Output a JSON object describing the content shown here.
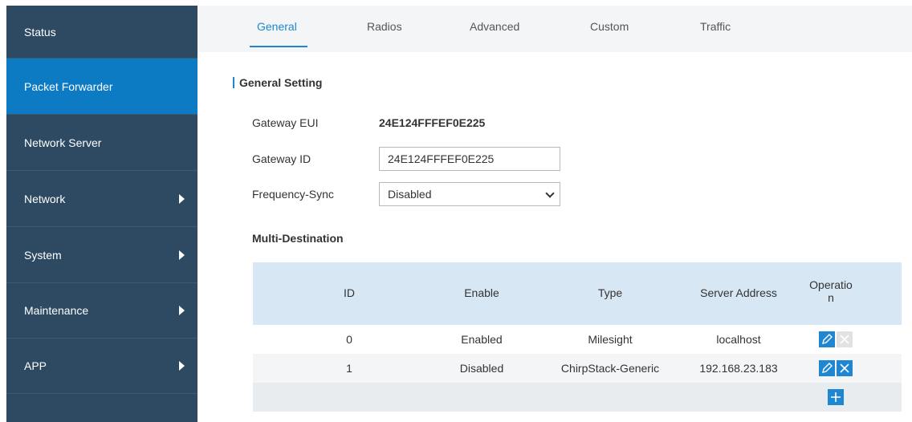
{
  "sidebar": {
    "items": [
      {
        "label": "Status"
      },
      {
        "label": "Packet Forwarder"
      },
      {
        "label": "Network Server"
      },
      {
        "label": "Network"
      },
      {
        "label": "System"
      },
      {
        "label": "Maintenance"
      },
      {
        "label": "APP"
      }
    ]
  },
  "tabs": [
    {
      "label": "General"
    },
    {
      "label": "Radios"
    },
    {
      "label": "Advanced"
    },
    {
      "label": "Custom"
    },
    {
      "label": "Traffic"
    }
  ],
  "general": {
    "section_title": "General Setting",
    "eui_label": "Gateway EUI",
    "eui_value": "24E124FFFEF0E225",
    "id_label": "Gateway ID",
    "id_value": "24E124FFFEF0E225",
    "freq_label": "Frequency-Sync",
    "freq_value": "Disabled"
  },
  "multi": {
    "title": "Multi-Destination",
    "headers": {
      "id": "ID",
      "enable": "Enable",
      "type": "Type",
      "server": "Server Address",
      "operation_1": "Operatio",
      "operation_2": "n"
    },
    "rows": [
      {
        "id": "0",
        "enable": "Enabled",
        "type": "Milesight",
        "server": "localhost"
      },
      {
        "id": "1",
        "enable": "Disabled",
        "type": "ChirpStack-Generic",
        "server": "192.168.23.183"
      }
    ]
  },
  "colors": {
    "sidebar": "#2e4a62",
    "sidebar_active": "#0d7ac4",
    "accent": "#1f87d1",
    "table_header": "#d8e7f4"
  }
}
